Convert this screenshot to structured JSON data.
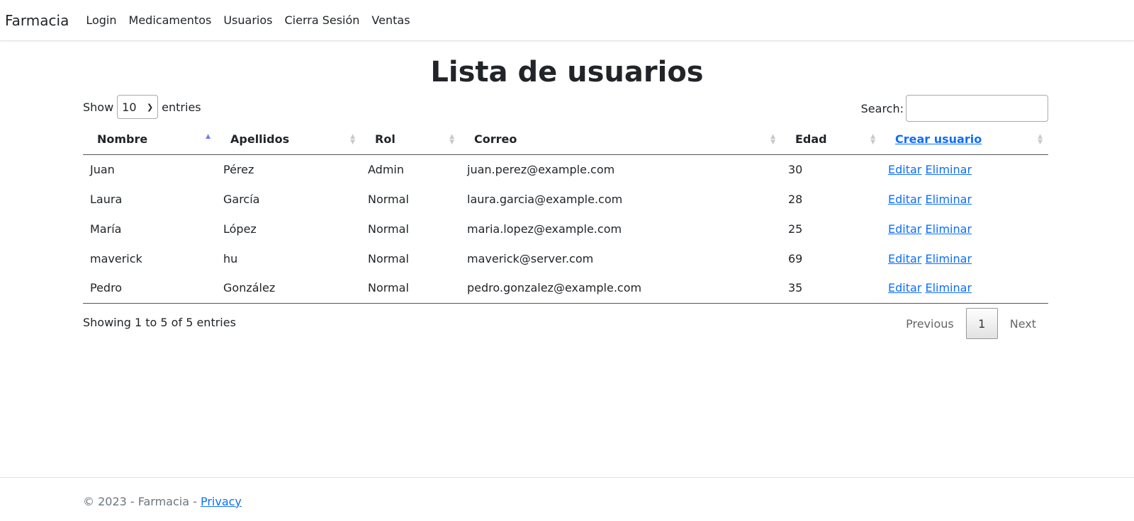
{
  "navbar": {
    "brand": "Farmacia",
    "links": [
      "Login",
      "Medicamentos",
      "Usuarios",
      "Cierra Sesión",
      "Ventas"
    ]
  },
  "page": {
    "title": "Lista de usuarios"
  },
  "table_controls": {
    "show_label": "Show",
    "entries_label": "entries",
    "page_length": "10",
    "search_label": "Search:",
    "search_value": ""
  },
  "table": {
    "headers": [
      "Nombre",
      "Apellidos",
      "Rol",
      "Correo",
      "Edad"
    ],
    "create_label": "Crear usuario",
    "rows": [
      {
        "nombre": "Juan",
        "apellidos": "Pérez",
        "rol": "Admin",
        "correo": "juan.perez@example.com",
        "edad": "30"
      },
      {
        "nombre": "Laura",
        "apellidos": "García",
        "rol": "Normal",
        "correo": "laura.garcia@example.com",
        "edad": "28"
      },
      {
        "nombre": "María",
        "apellidos": "López",
        "rol": "Normal",
        "correo": "maria.lopez@example.com",
        "edad": "25"
      },
      {
        "nombre": "maverick",
        "apellidos": "hu",
        "rol": "Normal",
        "correo": "maverick@server.com",
        "edad": "69"
      },
      {
        "nombre": "Pedro",
        "apellidos": "González",
        "rol": "Normal",
        "correo": "pedro.gonzalez@example.com",
        "edad": "35"
      }
    ],
    "edit_label": "Editar",
    "delete_label": "Eliminar"
  },
  "pagination": {
    "info": "Showing 1 to 5 of 5 entries",
    "previous": "Previous",
    "current_page": "1",
    "next": "Next"
  },
  "footer": {
    "text": "© 2023 - Farmacia - ",
    "privacy_link": "Privacy"
  },
  "colors": {
    "link": "#0d6efd",
    "text": "#212529",
    "muted": "#6c757d",
    "sort_active": "#6b7ee8"
  }
}
